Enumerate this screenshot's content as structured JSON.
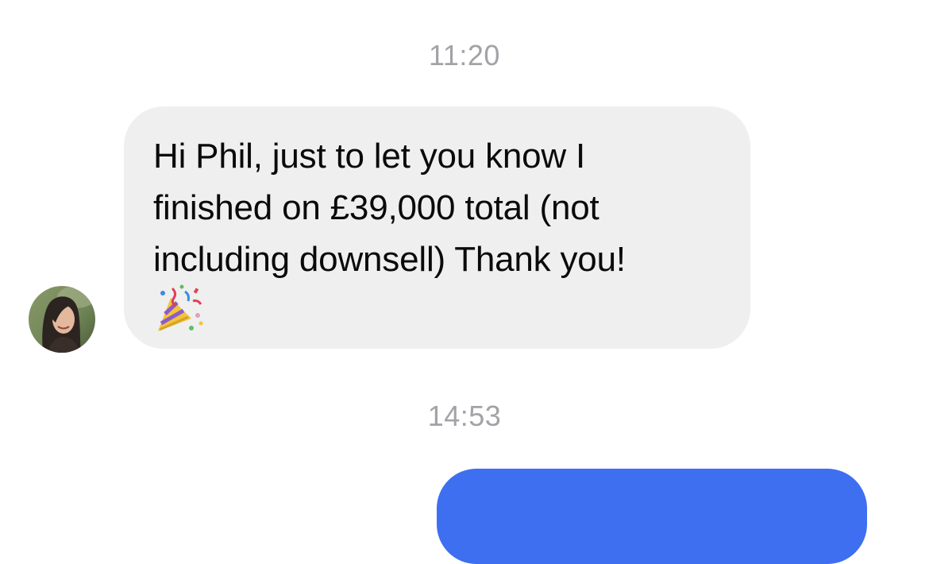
{
  "thread": {
    "timestamp_1": "11:20",
    "timestamp_2": "14:53"
  },
  "incoming_message": {
    "lines": [
      "Hi Phil, just to let you know I",
      "finished on £39,000 total (not",
      "including downsell) Thank you!"
    ],
    "emoji": "party-popper-icon",
    "bubble_color": "#efefef"
  },
  "sender_avatar": {
    "icon": "avatar"
  },
  "outgoing_message": {
    "bubble_color": "#3d6ff0"
  },
  "colors": {
    "timestamp": "#a2a2a7",
    "text": "#0a0a0a",
    "background": "#ffffff"
  }
}
